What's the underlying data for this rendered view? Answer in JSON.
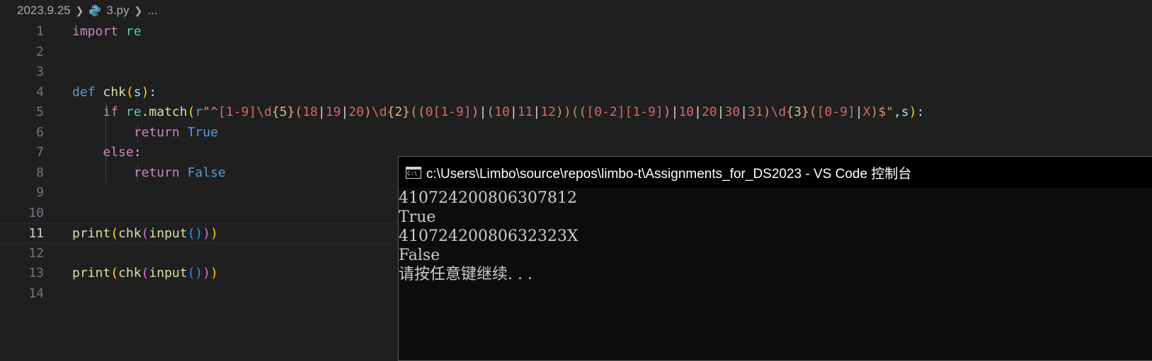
{
  "breadcrumb": {
    "folder": "2023.9.25",
    "file": "3.py",
    "more": "..."
  },
  "editor": {
    "line_numbers": [
      "1",
      "2",
      "3",
      "4",
      "5",
      "6",
      "7",
      "8",
      "9",
      "10",
      "11",
      "12",
      "13",
      "14"
    ],
    "current_line": 11,
    "lines": [
      [
        [
          "ctl",
          "import"
        ],
        [
          "txt",
          " "
        ],
        [
          "mod",
          "re"
        ]
      ],
      [],
      [],
      [
        [
          "kw",
          "def"
        ],
        [
          "txt",
          " "
        ],
        [
          "fn",
          "chk"
        ],
        [
          "p1",
          "("
        ],
        [
          "par",
          "s"
        ],
        [
          "p1",
          ")"
        ],
        [
          "txt",
          ":"
        ]
      ],
      [
        [
          "txt",
          "    "
        ],
        [
          "ctl",
          "if"
        ],
        [
          "txt",
          " "
        ],
        [
          "mod",
          "re"
        ],
        [
          "txt",
          "."
        ],
        [
          "fn",
          "match"
        ],
        [
          "p1",
          "("
        ],
        [
          "kw",
          "r"
        ],
        [
          "str",
          "\"^"
        ],
        [
          "rx",
          "[1-9]"
        ],
        [
          "rx",
          "\\d"
        ],
        [
          "rxq",
          "{5}"
        ],
        [
          "str",
          "("
        ],
        [
          "rx",
          "18"
        ],
        [
          "txt",
          "|"
        ],
        [
          "rx",
          "19"
        ],
        [
          "txt",
          "|"
        ],
        [
          "rx",
          "20"
        ],
        [
          "str",
          ")"
        ],
        [
          "rx",
          "\\d"
        ],
        [
          "rxq",
          "{2}"
        ],
        [
          "str",
          "(("
        ],
        [
          "rx",
          "0"
        ],
        [
          "rx",
          "[1-9]"
        ],
        [
          "str",
          ")"
        ],
        [
          "txt",
          "|"
        ],
        [
          "str",
          "("
        ],
        [
          "rx",
          "10"
        ],
        [
          "txt",
          "|"
        ],
        [
          "rx",
          "11"
        ],
        [
          "txt",
          "|"
        ],
        [
          "rx",
          "12"
        ],
        [
          "str",
          "))(("
        ],
        [
          "rx",
          "[0-2]"
        ],
        [
          "rx",
          "[1-9]"
        ],
        [
          "str",
          ")"
        ],
        [
          "txt",
          "|"
        ],
        [
          "rx",
          "10"
        ],
        [
          "txt",
          "|"
        ],
        [
          "rx",
          "20"
        ],
        [
          "txt",
          "|"
        ],
        [
          "rx",
          "30"
        ],
        [
          "txt",
          "|"
        ],
        [
          "rx",
          "31"
        ],
        [
          "str",
          ")"
        ],
        [
          "rx",
          "\\d"
        ],
        [
          "rxq",
          "{3}"
        ],
        [
          "str",
          "("
        ],
        [
          "rx",
          "[0-9]"
        ],
        [
          "txt",
          "|"
        ],
        [
          "rx",
          "X"
        ],
        [
          "str",
          ")$\""
        ],
        [
          "txt",
          ","
        ],
        [
          "par",
          "s"
        ],
        [
          "p1",
          ")"
        ],
        [
          "txt",
          ":"
        ]
      ],
      [
        [
          "txt",
          "        "
        ],
        [
          "ctl",
          "return"
        ],
        [
          "txt",
          " "
        ],
        [
          "kw",
          "True"
        ]
      ],
      [
        [
          "txt",
          "    "
        ],
        [
          "ctl",
          "else"
        ],
        [
          "txt",
          ":"
        ]
      ],
      [
        [
          "txt",
          "        "
        ],
        [
          "ctl",
          "return"
        ],
        [
          "txt",
          " "
        ],
        [
          "kw",
          "False"
        ]
      ],
      [],
      [],
      [
        [
          "fn",
          "print"
        ],
        [
          "p1",
          "("
        ],
        [
          "fn",
          "chk"
        ],
        [
          "p2",
          "("
        ],
        [
          "fn",
          "input"
        ],
        [
          "p3",
          "()"
        ],
        [
          "p2",
          ")"
        ],
        [
          "p1",
          ")"
        ]
      ],
      [],
      [
        [
          "fn",
          "print"
        ],
        [
          "p1",
          "("
        ],
        [
          "fn",
          "chk"
        ],
        [
          "p2",
          "("
        ],
        [
          "fn",
          "input"
        ],
        [
          "p3",
          "()"
        ],
        [
          "p2",
          ")"
        ],
        [
          "p1",
          ")"
        ]
      ],
      []
    ]
  },
  "console": {
    "icon_text": "C:\\",
    "title": "c:\\Users\\Limbo\\source\\repos\\limbo-t\\Assignments_for_DS2023 - VS Code 控制台",
    "output": [
      "410724200806307812",
      "True",
      "41072420080632323X",
      "False",
      "请按任意键继续. . ."
    ]
  }
}
